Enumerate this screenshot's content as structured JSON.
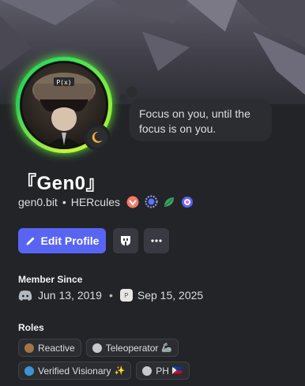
{
  "profile": {
    "display_name": "『Gen0』",
    "username": "gen0.bit",
    "server_tag": "HERcules",
    "separator": "•",
    "status_message": "Focus on you, until the focus is on you."
  },
  "avatar": {
    "hat_text": "P(x)"
  },
  "badges": [
    "nitro-badge",
    "hypesquad-badge",
    "leaf-badge",
    "quest-badge"
  ],
  "actions": {
    "edit_profile_label": "Edit Profile"
  },
  "member_since": {
    "title": "Member Since",
    "discord_date": "Jun 13, 2019",
    "server_date": "Sep 15, 2025",
    "separator": "•"
  },
  "roles_section": {
    "title": "Roles",
    "roles": [
      {
        "name": "Reactive",
        "color": "#a27545",
        "emoji": ""
      },
      {
        "name": "Teleoperator",
        "color": "#c7c9cc",
        "emoji": "🦾"
      },
      {
        "name": "Verified Visionary",
        "color": "#3b94d6",
        "emoji": "✨"
      },
      {
        "name": "PH",
        "color": "#c7c9cc",
        "emoji": "🇵🇭"
      }
    ]
  },
  "colors": {
    "accent": "#5865f2",
    "avatar_ring": "#5bea3c",
    "background": "#232428"
  }
}
